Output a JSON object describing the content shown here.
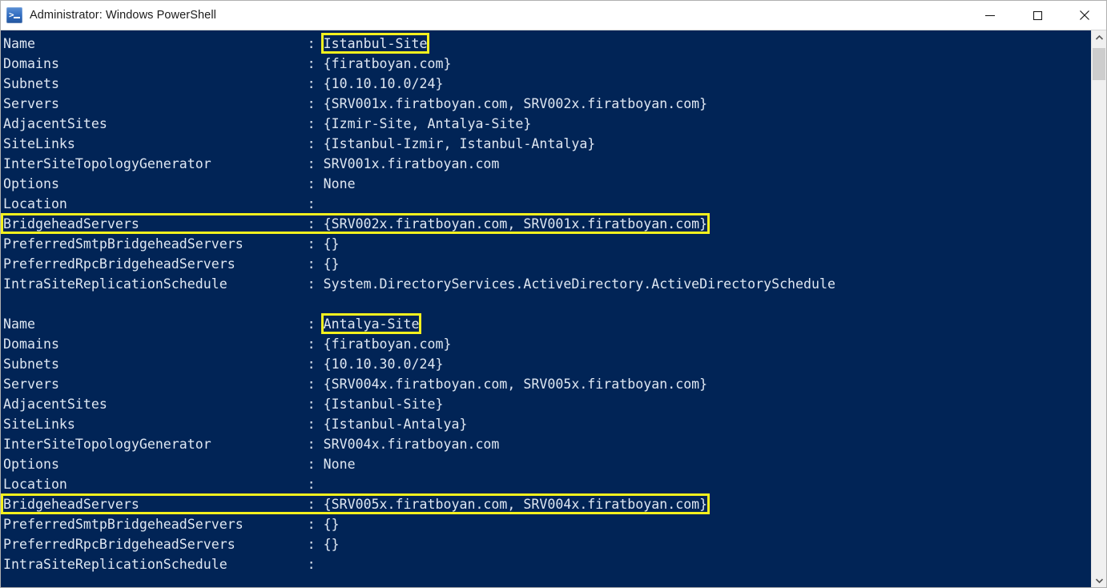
{
  "window": {
    "title": "Administrator: Windows PowerShell",
    "icon": "powershell-icon",
    "background_color": "#012456",
    "text_color": "#dfe7f2",
    "highlight_color": "#f5f01e",
    "controls": {
      "minimize": "minimize-icon",
      "maximize": "maximize-icon",
      "close": "close-icon"
    }
  },
  "scrollbar": {
    "up_arrow": "chevron-up-icon",
    "down_arrow": "chevron-down-icon",
    "thumb": "scrollbar-thumb"
  },
  "console": {
    "label_column_width": 38,
    "lines": [
      {
        "label": "Name",
        "value": "Istanbul-Site",
        "highlight": "value"
      },
      {
        "label": "Domains",
        "value": "{firatboyan.com}",
        "highlight": "none"
      },
      {
        "label": "Subnets",
        "value": "{10.10.10.0/24}",
        "highlight": "none"
      },
      {
        "label": "Servers",
        "value": "{SRV001x.firatboyan.com, SRV002x.firatboyan.com}",
        "highlight": "none"
      },
      {
        "label": "AdjacentSites",
        "value": "{Izmir-Site, Antalya-Site}",
        "highlight": "none"
      },
      {
        "label": "SiteLinks",
        "value": "{Istanbul-Izmir, Istanbul-Antalya}",
        "highlight": "none"
      },
      {
        "label": "InterSiteTopologyGenerator",
        "value": "SRV001x.firatboyan.com",
        "highlight": "none"
      },
      {
        "label": "Options",
        "value": "None",
        "highlight": "none"
      },
      {
        "label": "Location",
        "value": "",
        "highlight": "none"
      },
      {
        "label": "BridgeheadServers",
        "value": "{SRV002x.firatboyan.com, SRV001x.firatboyan.com}",
        "highlight": "row"
      },
      {
        "label": "PreferredSmtpBridgeheadServers",
        "value": "{}",
        "highlight": "none"
      },
      {
        "label": "PreferredRpcBridgeheadServers",
        "value": "{}",
        "highlight": "none"
      },
      {
        "label": "IntraSiteReplicationSchedule",
        "value": "System.DirectoryServices.ActiveDirectory.ActiveDirectorySchedule",
        "highlight": "none"
      },
      {
        "label": "",
        "value": "",
        "highlight": "none",
        "blank": true
      },
      {
        "label": "Name",
        "value": "Antalya-Site",
        "highlight": "value"
      },
      {
        "label": "Domains",
        "value": "{firatboyan.com}",
        "highlight": "none"
      },
      {
        "label": "Subnets",
        "value": "{10.10.30.0/24}",
        "highlight": "none"
      },
      {
        "label": "Servers",
        "value": "{SRV004x.firatboyan.com, SRV005x.firatboyan.com}",
        "highlight": "none"
      },
      {
        "label": "AdjacentSites",
        "value": "{Istanbul-Site}",
        "highlight": "none"
      },
      {
        "label": "SiteLinks",
        "value": "{Istanbul-Antalya}",
        "highlight": "none"
      },
      {
        "label": "InterSiteTopologyGenerator",
        "value": "SRV004x.firatboyan.com",
        "highlight": "none"
      },
      {
        "label": "Options",
        "value": "None",
        "highlight": "none"
      },
      {
        "label": "Location",
        "value": "",
        "highlight": "none"
      },
      {
        "label": "BridgeheadServers",
        "value": "{SRV005x.firatboyan.com, SRV004x.firatboyan.com}",
        "highlight": "row"
      },
      {
        "label": "PreferredSmtpBridgeheadServers",
        "value": "{}",
        "highlight": "none"
      },
      {
        "label": "PreferredRpcBridgeheadServers",
        "value": "{}",
        "highlight": "none"
      },
      {
        "label": "IntraSiteReplicationSchedule",
        "value": "",
        "highlight": "none"
      }
    ]
  }
}
